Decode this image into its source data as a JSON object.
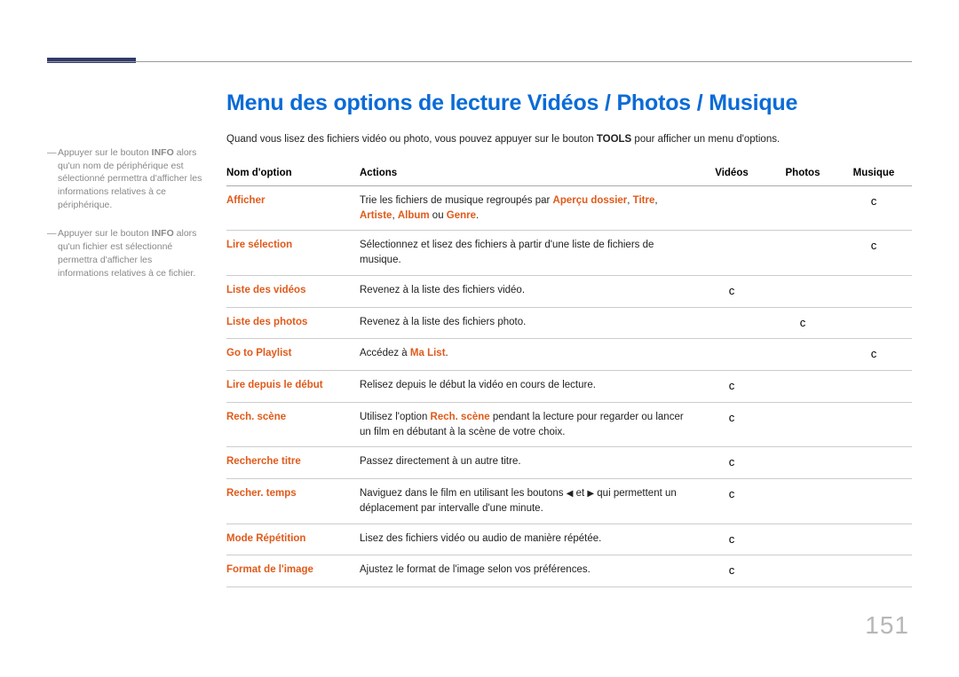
{
  "page_number": "151",
  "title": "Menu des options de lecture Vidéos / Photos / Musique",
  "intro": {
    "pre": "Quand vous lisez des fichiers vidéo ou photo, vous pouvez appuyer sur le bouton ",
    "bold": "TOOLS",
    "post": " pour afficher un menu d'options."
  },
  "side_notes": [
    {
      "pre": "Appuyer sur le bouton ",
      "bold": "INFO",
      "post": " alors qu'un nom de périphérique est sélectionné permettra d'afficher les informations relatives à ce périphérique."
    },
    {
      "pre": "Appuyer sur le bouton ",
      "bold": "INFO",
      "post": " alors qu'un fichier est sélectionné permettra d'afficher les informations relatives à ce fichier."
    }
  ],
  "table": {
    "headers": {
      "name": "Nom d'option",
      "actions": "Actions",
      "videos": "Vidéos",
      "photos": "Photos",
      "musique": "Musique"
    },
    "check_mark": "c",
    "rows": [
      {
        "name": "Afficher",
        "action_parts": [
          "Trie les fichiers de musique regroupés par ",
          {
            "hl": "Aperçu dossier"
          },
          ", ",
          {
            "hl": "Titre"
          },
          ", ",
          {
            "hl": "Artiste"
          },
          ", ",
          {
            "hl": "Album"
          },
          " ou ",
          {
            "hl": "Genre"
          },
          "."
        ],
        "v": false,
        "p": false,
        "m": true
      },
      {
        "name": "Lire sélection",
        "action_parts": [
          "Sélectionnez et lisez des fichiers à partir d'une liste de fichiers de musique."
        ],
        "v": false,
        "p": false,
        "m": true
      },
      {
        "name": "Liste des vidéos",
        "action_parts": [
          "Revenez à la liste des fichiers vidéo."
        ],
        "v": true,
        "p": false,
        "m": false
      },
      {
        "name": "Liste des photos",
        "action_parts": [
          "Revenez à la liste des fichiers photo."
        ],
        "v": false,
        "p": true,
        "m": false
      },
      {
        "name": "Go to Playlist",
        "action_parts": [
          "Accédez à ",
          {
            "hl": "Ma List"
          },
          "."
        ],
        "v": false,
        "p": false,
        "m": true
      },
      {
        "name": "Lire depuis le début",
        "action_parts": [
          "Relisez depuis le début la vidéo en cours de lecture."
        ],
        "v": true,
        "p": false,
        "m": false
      },
      {
        "name": "Rech. scène",
        "action_parts": [
          "Utilisez l'option ",
          {
            "hl": "Rech. scène"
          },
          " pendant la lecture pour regarder ou lancer un film en débutant à la scène de votre choix."
        ],
        "v": true,
        "p": false,
        "m": false
      },
      {
        "name": "Recherche titre",
        "action_parts": [
          "Passez directement à un autre titre."
        ],
        "v": true,
        "p": false,
        "m": false
      },
      {
        "name": "Recher. temps",
        "action_parts": [
          "Naviguez dans le film en utilisant les boutons ",
          {
            "glyph": "◀"
          },
          " et ",
          {
            "glyph": "▶"
          },
          " qui permettent un déplacement par intervalle d'une minute."
        ],
        "v": true,
        "p": false,
        "m": false
      },
      {
        "name": "Mode Répétition",
        "action_parts": [
          "Lisez des fichiers vidéo ou audio de manière répétée."
        ],
        "v": true,
        "p": false,
        "m": false
      },
      {
        "name": "Format de l'image",
        "action_parts": [
          "Ajustez le format de l'image selon vos préférences."
        ],
        "v": true,
        "p": false,
        "m": false
      }
    ]
  }
}
